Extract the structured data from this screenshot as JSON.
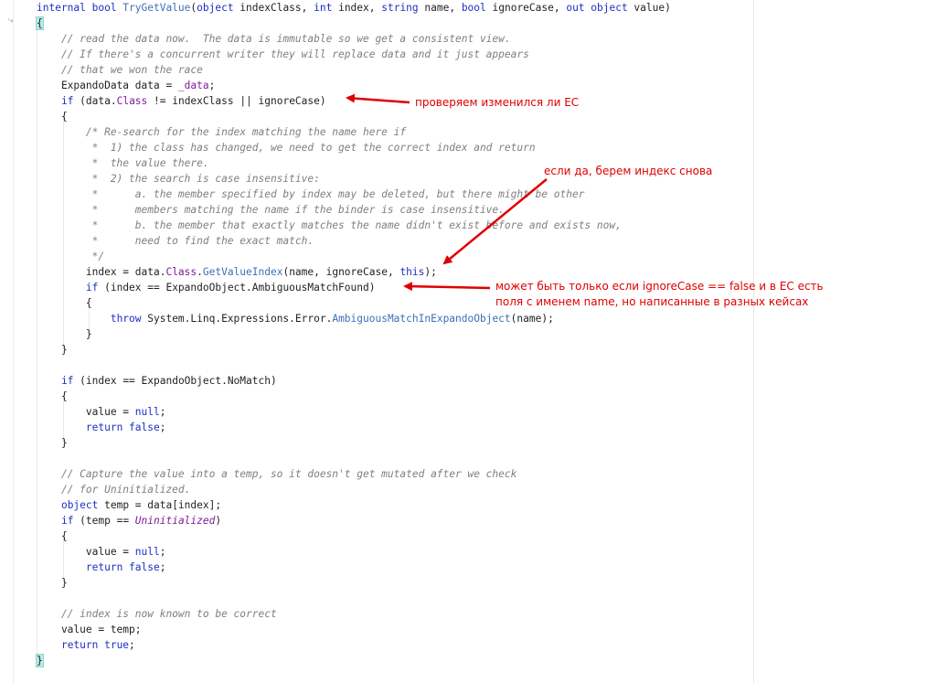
{
  "code_lines": [
    [
      {
        "t": "internal bool ",
        "c": "kw"
      },
      {
        "t": "TryGetValue",
        "c": "fn"
      },
      {
        "t": "(",
        "c": ""
      },
      {
        "t": "object",
        "c": "kw"
      },
      {
        "t": " indexClass, ",
        "c": ""
      },
      {
        "t": "int",
        "c": "kw"
      },
      {
        "t": " index, ",
        "c": ""
      },
      {
        "t": "string",
        "c": "kw"
      },
      {
        "t": " name, ",
        "c": ""
      },
      {
        "t": "bool",
        "c": "kw"
      },
      {
        "t": " ignoreCase, ",
        "c": ""
      },
      {
        "t": "out object",
        "c": "kw"
      },
      {
        "t": " value)",
        "c": ""
      }
    ],
    [
      {
        "t": "{",
        "c": "brace"
      }
    ],
    [
      {
        "t": "    // read the data now.  The data is immutable so we get a consistent view.",
        "c": "cm"
      }
    ],
    [
      {
        "t": "    // If there's a concurrent writer they will replace data and it just appears",
        "c": "cm"
      }
    ],
    [
      {
        "t": "    // that we won the race",
        "c": "cm"
      }
    ],
    [
      {
        "t": "    ExpandoData data = ",
        "c": ""
      },
      {
        "t": "_data",
        "c": "pu"
      },
      {
        "t": ";",
        "c": ""
      }
    ],
    [
      {
        "t": "    ",
        "c": ""
      },
      {
        "t": "if",
        "c": "kw"
      },
      {
        "t": " (data.",
        "c": ""
      },
      {
        "t": "Class",
        "c": "pu"
      },
      {
        "t": " != indexClass || ignoreCase)",
        "c": ""
      }
    ],
    [
      {
        "t": "    {",
        "c": ""
      }
    ],
    [
      {
        "t": "        /* Re-search for the index matching the name here if",
        "c": "cm"
      }
    ],
    [
      {
        "t": "         *  1) the class has changed, we need to get the correct index and return",
        "c": "cm"
      }
    ],
    [
      {
        "t": "         *  the value there.",
        "c": "cm"
      }
    ],
    [
      {
        "t": "         *  2) the search is case insensitive:",
        "c": "cm"
      }
    ],
    [
      {
        "t": "         *      a. the member specified by index may be deleted, but there might be other",
        "c": "cm"
      }
    ],
    [
      {
        "t": "         *      members matching the name if the binder is case insensitive.",
        "c": "cm"
      }
    ],
    [
      {
        "t": "         *      b. the member that exactly matches the name didn't exist before and exists now,",
        "c": "cm"
      }
    ],
    [
      {
        "t": "         *      need to find the exact match.",
        "c": "cm"
      }
    ],
    [
      {
        "t": "         */",
        "c": "cm"
      }
    ],
    [
      {
        "t": "        index = data.",
        "c": ""
      },
      {
        "t": "Class",
        "c": "pu"
      },
      {
        "t": ".",
        "c": ""
      },
      {
        "t": "GetValueIndex",
        "c": "fn"
      },
      {
        "t": "(name, ignoreCase, ",
        "c": ""
      },
      {
        "t": "this",
        "c": "kw"
      },
      {
        "t": ");",
        "c": ""
      }
    ],
    [
      {
        "t": "        ",
        "c": ""
      },
      {
        "t": "if",
        "c": "kw"
      },
      {
        "t": " (index == ExpandoObject.AmbiguousMatchFound)",
        "c": ""
      }
    ],
    [
      {
        "t": "        {",
        "c": ""
      }
    ],
    [
      {
        "t": "            ",
        "c": ""
      },
      {
        "t": "throw",
        "c": "kw"
      },
      {
        "t": " System.Linq.Expressions.Error.",
        "c": ""
      },
      {
        "t": "AmbiguousMatchInExpandoObject",
        "c": "fn"
      },
      {
        "t": "(name);",
        "c": ""
      }
    ],
    [
      {
        "t": "        }",
        "c": ""
      }
    ],
    [
      {
        "t": "    }",
        "c": ""
      }
    ],
    [
      {
        "t": "",
        "c": ""
      }
    ],
    [
      {
        "t": "    ",
        "c": ""
      },
      {
        "t": "if",
        "c": "kw"
      },
      {
        "t": " (index == ExpandoObject.NoMatch)",
        "c": ""
      }
    ],
    [
      {
        "t": "    {",
        "c": ""
      }
    ],
    [
      {
        "t": "        value = ",
        "c": ""
      },
      {
        "t": "null",
        "c": "kw"
      },
      {
        "t": ";",
        "c": ""
      }
    ],
    [
      {
        "t": "        ",
        "c": ""
      },
      {
        "t": "return false",
        "c": "kw"
      },
      {
        "t": ";",
        "c": ""
      }
    ],
    [
      {
        "t": "    }",
        "c": ""
      }
    ],
    [
      {
        "t": "",
        "c": ""
      }
    ],
    [
      {
        "t": "    // Capture the value into a temp, so it doesn't get mutated after we check",
        "c": "cm"
      }
    ],
    [
      {
        "t": "    // for Uninitialized.",
        "c": "cm"
      }
    ],
    [
      {
        "t": "    ",
        "c": ""
      },
      {
        "t": "object",
        "c": "kw"
      },
      {
        "t": " temp = data[index];",
        "c": ""
      }
    ],
    [
      {
        "t": "    ",
        "c": ""
      },
      {
        "t": "if",
        "c": "kw"
      },
      {
        "t": " (temp == ",
        "c": ""
      },
      {
        "t": "Uninitialized",
        "c": "puit"
      },
      {
        "t": ")",
        "c": ""
      }
    ],
    [
      {
        "t": "    {",
        "c": ""
      }
    ],
    [
      {
        "t": "        value = ",
        "c": ""
      },
      {
        "t": "null",
        "c": "kw"
      },
      {
        "t": ";",
        "c": ""
      }
    ],
    [
      {
        "t": "        ",
        "c": ""
      },
      {
        "t": "return false",
        "c": "kw"
      },
      {
        "t": ";",
        "c": ""
      }
    ],
    [
      {
        "t": "    }",
        "c": ""
      }
    ],
    [
      {
        "t": "",
        "c": ""
      }
    ],
    [
      {
        "t": "    // index is now known to be correct",
        "c": "cm"
      }
    ],
    [
      {
        "t": "    value = temp;",
        "c": ""
      }
    ],
    [
      {
        "t": "    ",
        "c": ""
      },
      {
        "t": "return true",
        "c": "kw"
      },
      {
        "t": ";",
        "c": ""
      }
    ],
    [
      {
        "t": "}",
        "c": "brace"
      }
    ]
  ],
  "annotations": {
    "class_changed": "проверяем изменился ли ЕС",
    "if_yes": "если да, берем индекс снова",
    "ambiguous_line1": "может быть только если ignoreCase == false и в ЕС есть",
    "ambiguous_line2": "поля с именем name, но написанные в разных кейсах"
  },
  "colors": {
    "keyword": "#1d2fc4",
    "comment": "#7f7f7f",
    "method": "#3e6fb8",
    "field": "#7f1c9a",
    "annotation": "#e00000",
    "brace_highlight": "#b8ece6"
  },
  "icons": {
    "gutter_marker": "step-arrow-icon"
  }
}
